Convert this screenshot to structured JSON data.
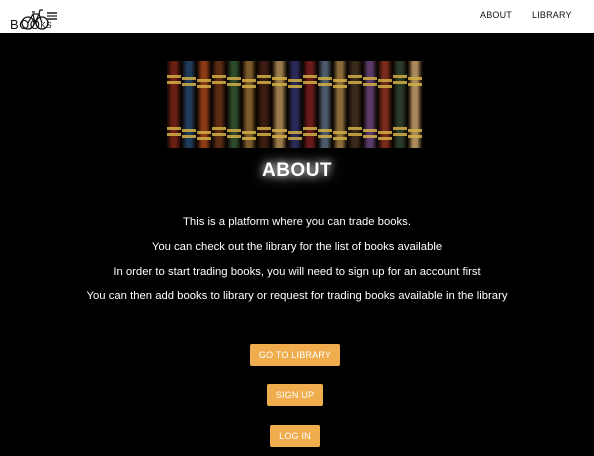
{
  "navbar": {
    "logo_text_main": "BOO",
    "logo_text_small": "KS",
    "links": [
      {
        "label": "ABOUT"
      },
      {
        "label": "LIBRARY"
      }
    ]
  },
  "banner": {
    "spine_colors": [
      "#6b1e12",
      "#1f3b5a",
      "#8a3b14",
      "#5a2a12",
      "#2b4a2a",
      "#7a5a2a",
      "#3a1c10",
      "#9a7a4a",
      "#2a2a5a",
      "#6a1a1a",
      "#4a5a6a",
      "#8a6a3a",
      "#3a2a1a",
      "#5a3a6a",
      "#7a2a1a",
      "#2a3a2a",
      "#aa8a5a"
    ]
  },
  "main": {
    "title": "ABOUT",
    "paragraphs": [
      "This is a platform where you can trade books.",
      "You can check out the library for the list of books available",
      "In order to start trading books, you will need to sign up for an account first",
      "You can then add books to library or request for trading books available in the library"
    ],
    "buttons": {
      "library": "GO TO LIBRARY",
      "signup": "SIGN UP",
      "login": "LOG IN"
    }
  },
  "colors": {
    "accent": "#f0ad4e",
    "background": "#000000",
    "navbar": "#ffffff"
  }
}
